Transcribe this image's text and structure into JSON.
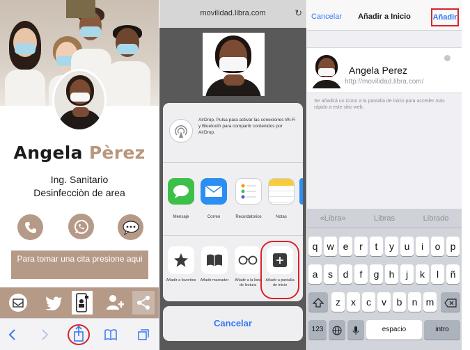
{
  "panel1": {
    "name_first": "Angela",
    "name_last": "Pèrez",
    "title_line1": "Ing. Sanitario",
    "title_line2": "Desinfecciòn de area",
    "cta_text": "Para  tomar una cita presione aqui",
    "accent_color": "#b69a88",
    "contact_icons": [
      "phone-icon",
      "whatsapp-icon",
      "chat-bubble-icon"
    ],
    "footer_icons": [
      "mail-icon",
      "twitter-icon",
      "contact-card-icon",
      "add-user-icon",
      "share-icon"
    ],
    "browser_icons": [
      "back-icon",
      "forward-icon",
      "share-icon",
      "bookmarks-icon",
      "tabs-icon"
    ]
  },
  "panel2": {
    "url": "movilidad.libra.com",
    "airdrop_text": "AirDrop. Pulsa para activar las conexiones Wi-Fi y Bluetooth para compartir contenidos por AirDrop.",
    "apps": [
      {
        "label": "Mensaje",
        "icon": "messages-icon"
      },
      {
        "label": "Correo",
        "icon": "mail-icon"
      },
      {
        "label": "Recordatorios",
        "icon": "reminders-icon"
      },
      {
        "label": "Notas",
        "icon": "notes-icon"
      }
    ],
    "actions": [
      {
        "label": "Añadir a favoritos",
        "icon": "star-icon"
      },
      {
        "label": "Añadir marcador",
        "icon": "book-icon"
      },
      {
        "label": "Añadir a la lista de lectura",
        "icon": "glasses-icon"
      },
      {
        "label": "Añadir a pantalla de inicio",
        "icon": "plus-icon"
      }
    ],
    "cancel_label": "Cancelar"
  },
  "panel3": {
    "cancel_label": "Cancelar",
    "title": "Añadir a Inicio",
    "add_label": "Añadir",
    "name_value": "Angela Perez",
    "url": "http://movilidad.libra.com/",
    "hint": "Se añadirá un icono a la pantalla de inicio para acceder más rápido a este sitio web.",
    "suggestions": [
      "«Libra»",
      "Libras",
      "Librado"
    ],
    "row1": [
      "q",
      "w",
      "e",
      "r",
      "t",
      "y",
      "u",
      "i",
      "o",
      "p"
    ],
    "row2": [
      "a",
      "s",
      "d",
      "f",
      "g",
      "h",
      "j",
      "k",
      "l",
      "ñ"
    ],
    "row3": [
      "z",
      "x",
      "c",
      "v",
      "b",
      "n",
      "m"
    ],
    "key_123": "123",
    "key_space": "espacio",
    "key_return": "intro"
  }
}
